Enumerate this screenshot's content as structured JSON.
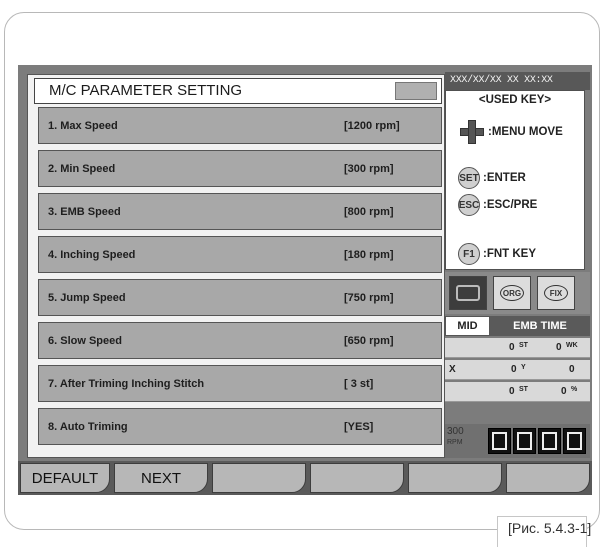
{
  "dialog": {
    "title": "M/C PARAMETER SETTING",
    "rows": [
      {
        "label": "1. Max Speed",
        "value": "[1200 rpm]"
      },
      {
        "label": "2. Min Speed",
        "value": "[300 rpm]"
      },
      {
        "label": "3. EMB Speed",
        "value": "[800 rpm]"
      },
      {
        "label": "4. Inching Speed",
        "value": "[180 rpm]"
      },
      {
        "label": "5. Jump Speed",
        "value": "[750 rpm]"
      },
      {
        "label": "6. Slow Speed",
        "value": "[650 rpm]"
      },
      {
        "label": "7. After Triming Inching Stitch",
        "value": "[ 3 st]"
      },
      {
        "label": "8. Auto Triming",
        "value": "[YES]"
      }
    ]
  },
  "status": {
    "datetime": "XXX/XX/XX XX XX:XX"
  },
  "used_keys": {
    "title": "<USED KEY>",
    "menu_move": ":MENU MOVE",
    "set_key": "SET",
    "enter": ":ENTER",
    "esc_key": "ESC",
    "esc_pre": ":ESC/PRE",
    "f1_key": "F1",
    "fnt_key": ":FNT KEY"
  },
  "icons": {
    "orc": "ORG",
    "fix": "FIX"
  },
  "mode": {
    "mid": "MID",
    "emb_time": "EMB TIME"
  },
  "counters": {
    "st1": "0",
    "st1_unit": "ST",
    "wk": "0",
    "wk_unit": "WK",
    "x_label": "X",
    "y_value": "0",
    "y_label": "Y",
    "y2": "0",
    "st2": "0",
    "st2_unit": "ST",
    "pct": "0",
    "pct_unit": "%"
  },
  "rpm": {
    "value": "300",
    "unit": "RPM"
  },
  "softkeys": {
    "default": "DEFAULT",
    "next": "NEXT"
  },
  "caption": "[Рис. 5.4.3-1]",
  "colors": {
    "screen_bg": "#7c7c7c",
    "row_bg": "#a8a8a8",
    "dialog_bg": "#f2f2f2"
  }
}
